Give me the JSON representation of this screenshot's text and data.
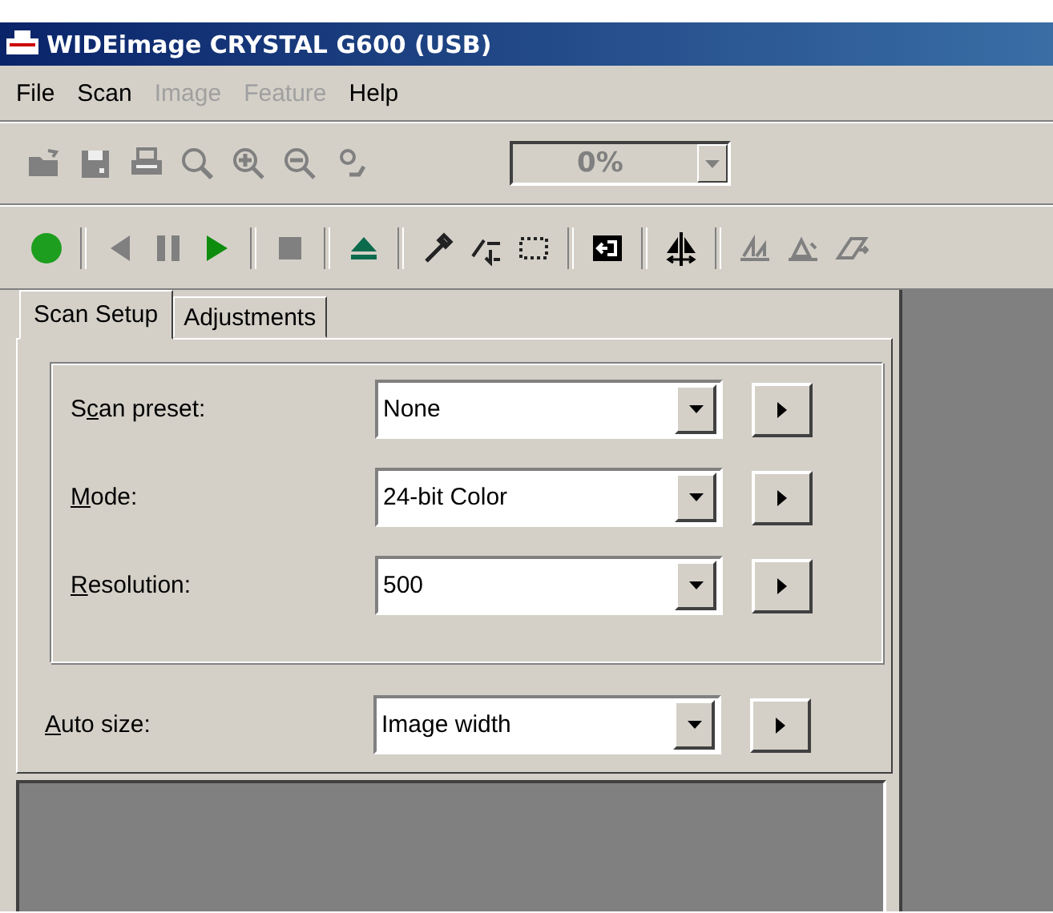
{
  "window": {
    "title": "WIDEimage CRYSTAL G600 (USB)"
  },
  "menu": [
    {
      "label": "File",
      "disabled": false
    },
    {
      "label": "Scan",
      "disabled": false
    },
    {
      "label": "Image",
      "disabled": true
    },
    {
      "label": "Feature",
      "disabled": true
    },
    {
      "label": "Help",
      "disabled": false
    }
  ],
  "toolbar_1": {
    "buttons": [
      {
        "disabled": true
      },
      {
        "disabled": true
      },
      {
        "disabled": true
      },
      {
        "disabled": true
      },
      {
        "disabled": true
      },
      {
        "disabled": true
      },
      {
        "disabled": true
      }
    ],
    "zoom": {
      "value": "0%",
      "disabled": true
    }
  },
  "toolbar_2": {
    "buttons": [
      {
        "disabled": false
      },
      {
        "disabled": true
      },
      {
        "disabled": true
      },
      {
        "disabled": false
      },
      {
        "disabled": true
      },
      {
        "disabled": false
      },
      {
        "disabled": false
      },
      {
        "disabled": false
      },
      {
        "disabled": false
      },
      {
        "disabled": false
      },
      {
        "disabled": false
      },
      {
        "disabled": true
      },
      {
        "disabled": true
      },
      {
        "disabled": true
      }
    ]
  },
  "tabs": [
    {
      "label": "Scan Setup",
      "selected": true
    },
    {
      "label": "Adjustments",
      "selected": false
    }
  ],
  "group_fields": [
    {
      "label_before": "S",
      "access_key": "c",
      "label_after": "an preset:",
      "value": "None"
    },
    {
      "access_key": "M",
      "label_after": "ode:",
      "value": "24-bit Color"
    },
    {
      "access_key": "R",
      "label_after": "esolution:",
      "value": "500"
    }
  ],
  "auto_size": {
    "access_key": "A",
    "label_after": "uto size:",
    "value": "Image width"
  }
}
